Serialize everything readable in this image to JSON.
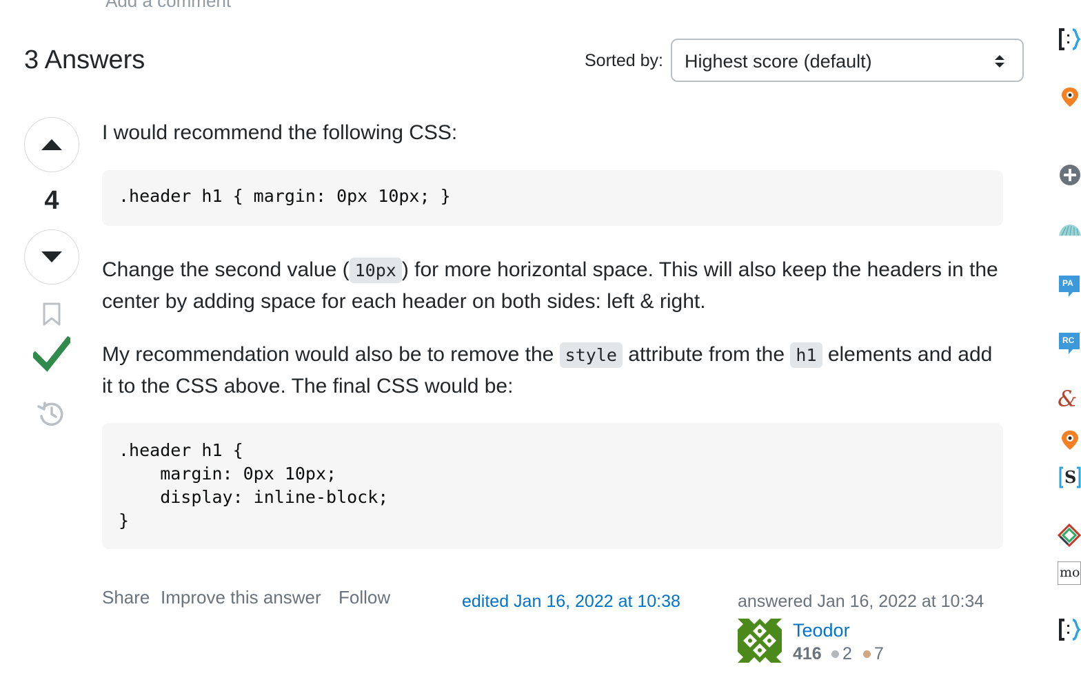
{
  "comments": {
    "add_comment": "Add a comment"
  },
  "answers_header": {
    "title": "3 Answers",
    "sorted_by_label": "Sorted by:",
    "sort_value": "Highest score (default)"
  },
  "answer": {
    "score": "4",
    "is_accepted": true,
    "paragraph1": "I would recommend the following CSS:",
    "code1": ".header h1 { margin: 0px 10px; }",
    "paragraph2": {
      "before": "Change the second value (",
      "code": "10px",
      "after": ") for more horizontal space. This will also keep the headers in the center by adding space for each header on both sides: left & right."
    },
    "paragraph3": {
      "part1": "My recommendation would also be to remove the ",
      "code1": "style",
      "part2": " attribute from the ",
      "code2": "h1",
      "part3": " elements and add it to the CSS above. The final CSS would be:"
    },
    "code2": ".header h1 {\n    margin: 0px 10px;\n    display: inline-block;\n}",
    "menu": {
      "share": "Share",
      "improve": "Improve this answer",
      "follow": "Follow"
    },
    "edited": "edited Jan 16, 2022 at 10:38",
    "answered": "answered Jan 16, 2022 at 10:34",
    "user": {
      "name": "Teodor",
      "reputation": "416",
      "silver_badges": "2",
      "bronze_badges": "7"
    }
  },
  "colors": {
    "accent_link": "#0074cc",
    "accepted_green": "#2f8a4b",
    "silver": "#b4b8bc",
    "bronze": "#d1a684",
    "avatar_green": "#4b8a1a"
  },
  "right_rail_icons": [
    "bracket-logo-icon",
    "map-pin-icon",
    "plus-circle-icon",
    "cloud-icon",
    "pa-chat-icon",
    "rc-chat-icon",
    "ampersand-icon",
    "map-pin-icon",
    "s-logo-icon",
    "diamond-logo-icon",
    "mo-logo-icon",
    "bracket-logo-icon"
  ],
  "right_rail_text": {
    "pa": "PA",
    "rc": "RC",
    "amp": "&",
    "s": "S",
    "mo": "mo"
  }
}
